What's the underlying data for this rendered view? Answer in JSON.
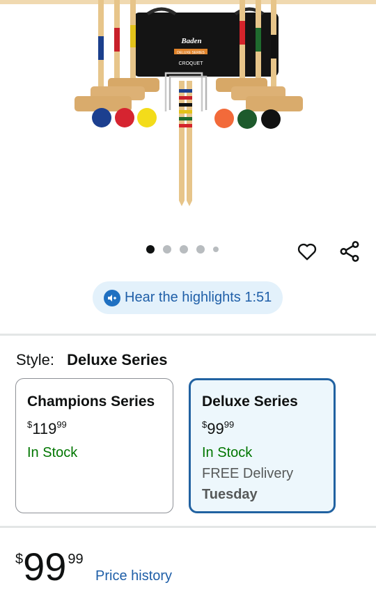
{
  "product": {
    "image_alt": "Croquet set with mallets, balls, wickets and stakes",
    "bag_brand": "Baden",
    "bag_series": "DELUXE SERIES",
    "bag_label": "CROQUET"
  },
  "carousel": {
    "total_dots": 5,
    "active_index": 0
  },
  "actions": {
    "favorite_icon": "heart-icon",
    "share_icon": "share-icon"
  },
  "highlights": {
    "label": "Hear the highlights 1:51"
  },
  "style": {
    "label": "Style:",
    "selected": "Deluxe Series",
    "options": [
      {
        "title": "Champions Series",
        "currency": "$",
        "whole": "119",
        "fraction": "99",
        "stock": "In Stock"
      },
      {
        "title": "Deluxe Series",
        "currency": "$",
        "whole": "99",
        "fraction": "99",
        "stock": "In Stock",
        "delivery": "FREE Delivery",
        "delivery_day": "Tuesday"
      }
    ]
  },
  "price": {
    "currency": "$",
    "whole": "99",
    "fraction": "99",
    "history_link": "Price history"
  },
  "colors": {
    "accent": "#2162a1",
    "instock": "#007600",
    "link": "#1f5fa8"
  }
}
